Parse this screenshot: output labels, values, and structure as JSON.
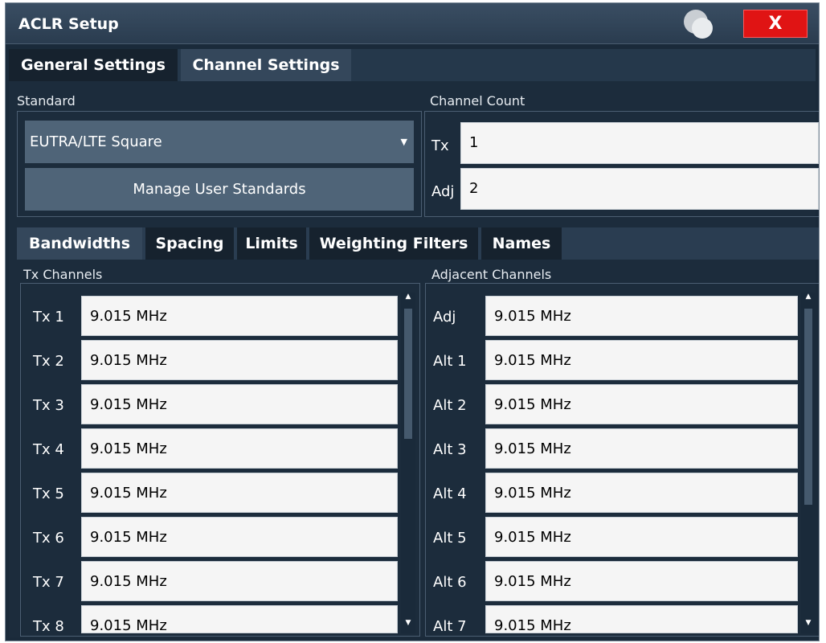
{
  "window": {
    "title": "ACLR Setup",
    "close_label": "X"
  },
  "main_tabs": [
    {
      "label": "General Settings",
      "active": false
    },
    {
      "label": "Channel Settings",
      "active": true
    }
  ],
  "standard": {
    "group_label": "Standard",
    "selected": "EUTRA/LTE Square",
    "manage_button": "Manage User Standards"
  },
  "channel_count": {
    "group_label": "Channel Count",
    "tx_label": "Tx",
    "tx_value": "1",
    "adj_label": "Adj",
    "adj_value": "2"
  },
  "sub_tabs": [
    {
      "label": "Bandwidths",
      "active": true
    },
    {
      "label": "Spacing",
      "active": false
    },
    {
      "label": "Limits",
      "active": false
    },
    {
      "label": "Weighting Filters",
      "active": false
    },
    {
      "label": "Names",
      "active": false
    }
  ],
  "tx_channels": {
    "group_label": "Tx Channels",
    "rows": [
      {
        "label": "Tx 1",
        "value": "9.015 MHz"
      },
      {
        "label": "Tx 2",
        "value": "9.015 MHz"
      },
      {
        "label": "Tx 3",
        "value": "9.015 MHz"
      },
      {
        "label": "Tx 4",
        "value": "9.015 MHz"
      },
      {
        "label": "Tx 5",
        "value": "9.015 MHz"
      },
      {
        "label": "Tx 6",
        "value": "9.015 MHz"
      },
      {
        "label": "Tx 7",
        "value": "9.015 MHz"
      },
      {
        "label": "Tx 8",
        "value": "9.015 MHz"
      }
    ]
  },
  "adjacent_channels": {
    "group_label": "Adjacent Channels",
    "rows": [
      {
        "label": "Adj",
        "value": "9.015 MHz"
      },
      {
        "label": "Alt 1",
        "value": "9.015 MHz"
      },
      {
        "label": "Alt 2",
        "value": "9.015 MHz"
      },
      {
        "label": "Alt 3",
        "value": "9.015 MHz"
      },
      {
        "label": "Alt 4",
        "value": "9.015 MHz"
      },
      {
        "label": "Alt 5",
        "value": "9.015 MHz"
      },
      {
        "label": "Alt 6",
        "value": "9.015 MHz"
      },
      {
        "label": "Alt 7",
        "value": "9.015 MHz"
      }
    ]
  },
  "colors": {
    "title_bar": "#2f4357",
    "close_button": "#e01414",
    "panel_bg": "#1a2a3a",
    "control_bg": "#4f6478",
    "field_bg": "#f5f5f5"
  }
}
